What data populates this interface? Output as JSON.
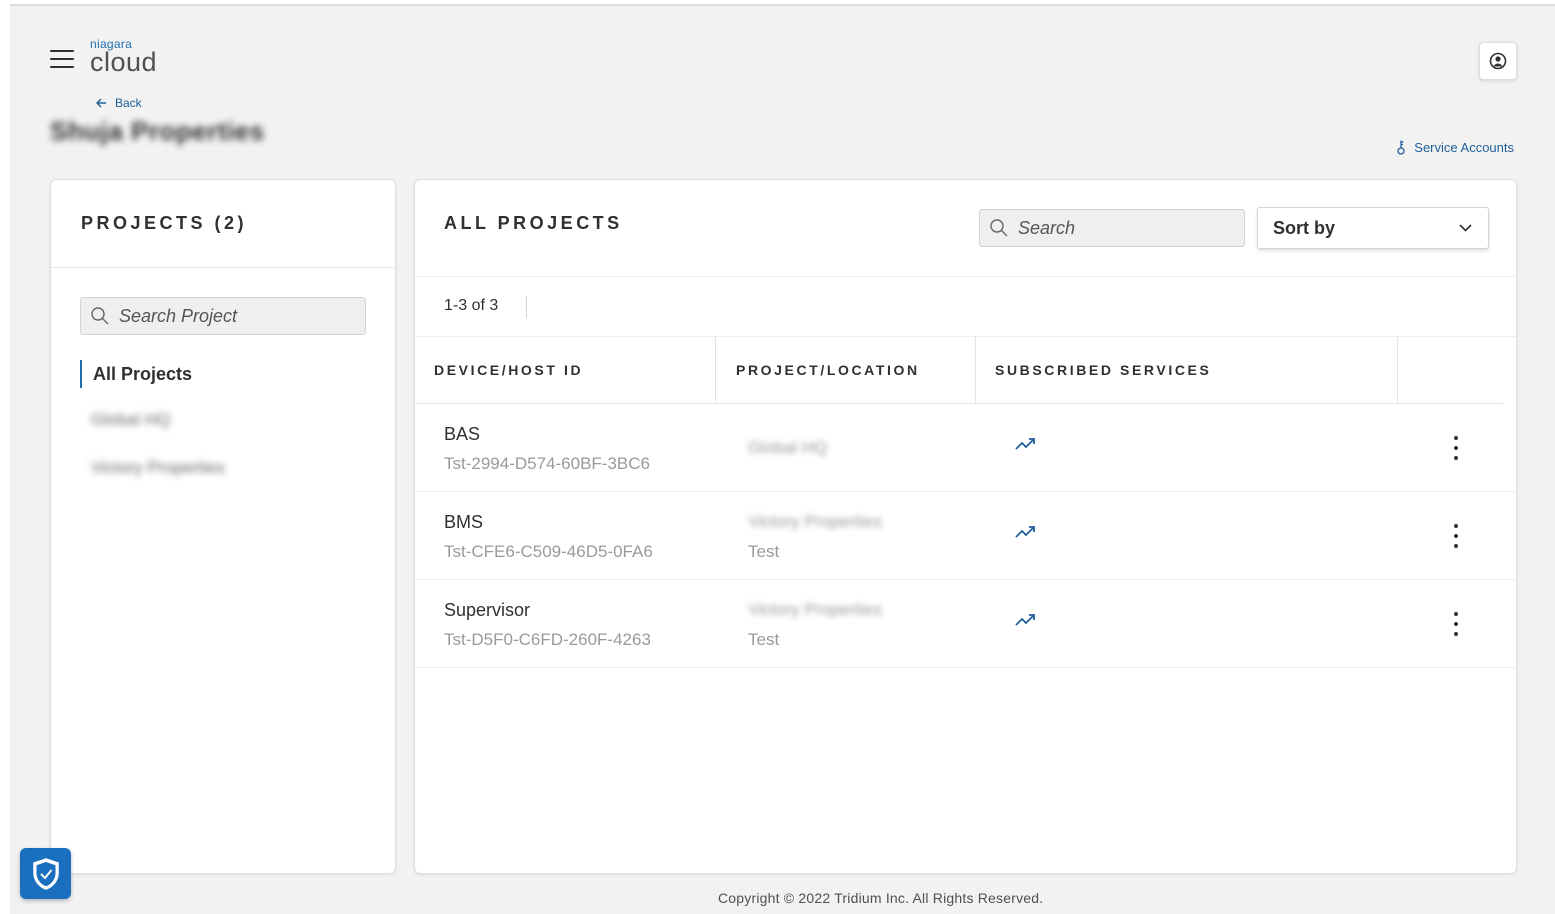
{
  "header": {
    "logo_small": "niagara",
    "logo_big": "cloud",
    "back_label": "Back",
    "page_title": "Shuja Properties",
    "service_accounts_label": "Service Accounts"
  },
  "sidebar": {
    "title": "PROJECTS (2)",
    "search_placeholder": "Search Project",
    "items": [
      {
        "label": "All Projects",
        "active": true
      },
      {
        "label": "Global HQ"
      },
      {
        "label": "Victory Properties"
      }
    ]
  },
  "main": {
    "title": "ALL PROJECTS",
    "search_placeholder": "Search",
    "sort_label": "Sort by",
    "count_text": "1-3 of 3",
    "columns": [
      "DEVICE/HOST ID",
      "PROJECT/LOCATION",
      "SUBSCRIBED SERVICES"
    ],
    "rows": [
      {
        "name": "BAS",
        "host_id": "Tst-2994-D574-60BF-3BC6",
        "project": "Global HQ",
        "location": ""
      },
      {
        "name": "BMS",
        "host_id": "Tst-CFE6-C509-46D5-0FA6",
        "project": "Victory Properties",
        "location": "Test"
      },
      {
        "name": "Supervisor",
        "host_id": "Tst-D5F0-C6FD-260F-4263",
        "project": "Victory Properties",
        "location": "Test"
      }
    ]
  },
  "footer": {
    "copyright": "Copyright © 2022 Tridium Inc. All Rights Reserved."
  },
  "icons": {
    "menu": "hamburger-menu-icon",
    "user": "user-icon",
    "back": "arrow-left-icon",
    "service_accounts": "key-icon",
    "search": "search-icon",
    "sort": "chevron-down-icon",
    "service": "trending-up-icon",
    "row_menu": "more-vertical-icon",
    "security": "shield-check-icon"
  },
  "colors": {
    "accent": "#1f6fb2",
    "background": "#f2f2f2",
    "shield": "#1a6fbf"
  }
}
